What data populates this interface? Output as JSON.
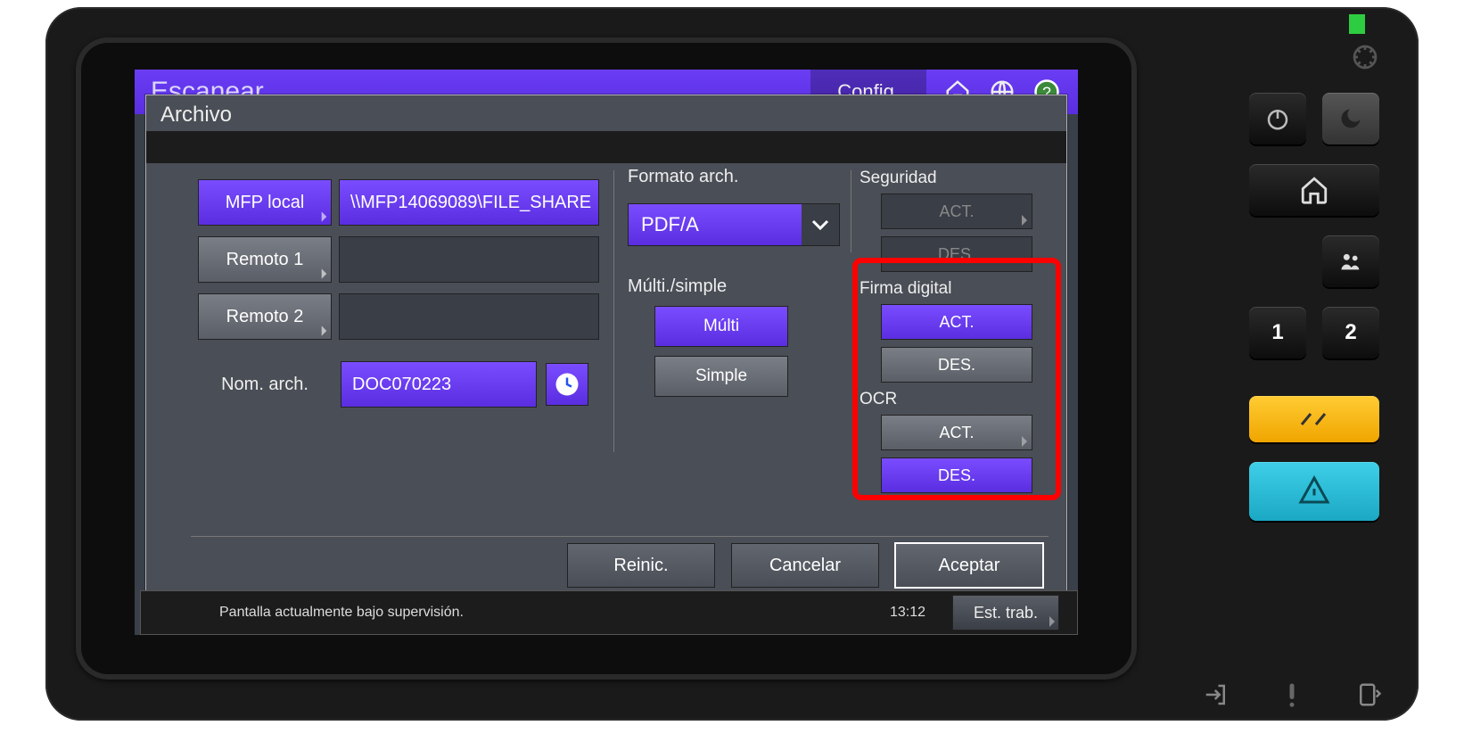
{
  "topbar": {
    "title": "Escanear",
    "config": "Config."
  },
  "dialog": {
    "title": "Archivo",
    "dest": {
      "mfp_local_label": "MFP local",
      "mfp_local_value": "\\\\MFP14069089\\FILE_SHARE",
      "remote1_label": "Remoto 1",
      "remote1_value": "",
      "remote2_label": "Remoto 2",
      "remote2_value": "",
      "filename_label": "Nom. arch.",
      "filename_value": "DOC070223"
    },
    "format": {
      "label": "Formato arch.",
      "value": "PDF/A"
    },
    "multi": {
      "label": "Múlti./simple",
      "multi": "Múlti",
      "simple": "Simple"
    },
    "security": {
      "label": "Seguridad",
      "on": "ACT.",
      "off": "DES."
    },
    "signature": {
      "label": "Firma digital",
      "on": "ACT.",
      "off": "DES."
    },
    "ocr": {
      "label": "OCR",
      "on": "ACT.",
      "off": "DES."
    },
    "footer": {
      "reset": "Reinic.",
      "cancel": "Cancelar",
      "ok": "Aceptar"
    }
  },
  "status": {
    "message": "Pantalla actualmente bajo supervisión.",
    "time": "13:12",
    "jobs": "Est. trab."
  },
  "hw": {
    "num1": "1",
    "num2": "2"
  }
}
